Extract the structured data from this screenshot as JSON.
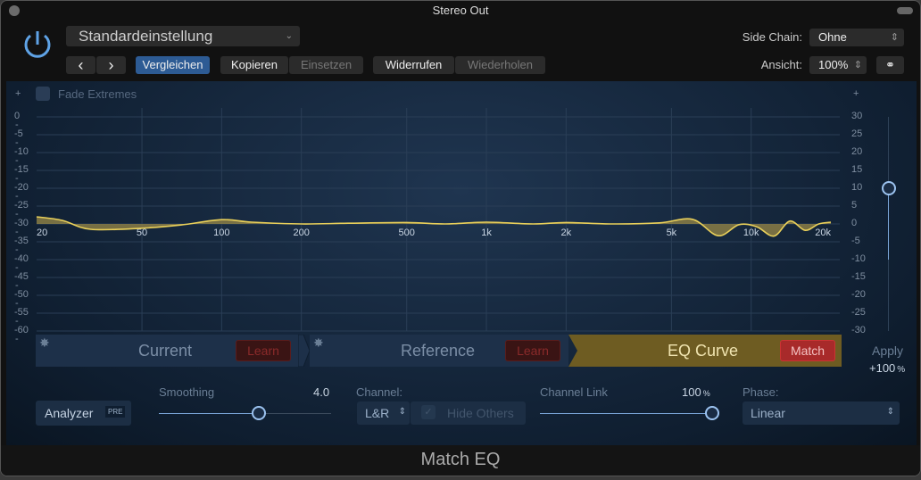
{
  "window": {
    "title": "Stereo Out"
  },
  "header": {
    "preset": "Standardeinstellung",
    "compare": "Vergleichen",
    "copy": "Kopieren",
    "paste": "Einsetzen",
    "undo": "Widerrufen",
    "redo": "Wiederholen",
    "prev": "‹",
    "next": "›",
    "side_chain_label": "Side Chain:",
    "side_chain_value": "Ohne",
    "view_label": "Ansicht:",
    "view_value": "100%"
  },
  "graph": {
    "fade_extremes": "Fade Extremes",
    "fade_extremes_checked": false,
    "left_scale": [
      "0",
      "-5",
      "-10",
      "-15",
      "-20",
      "-25",
      "-30",
      "-35",
      "-40",
      "-45",
      "-50",
      "-55",
      "-60"
    ],
    "right_scale": [
      "30",
      "25",
      "20",
      "15",
      "10",
      "5",
      "0",
      "-5",
      "-10",
      "-15",
      "-20",
      "-25",
      "-30"
    ],
    "freq_labels": [
      {
        "f": 20,
        "t": "20"
      },
      {
        "f": 50,
        "t": "50"
      },
      {
        "f": 100,
        "t": "100"
      },
      {
        "f": 200,
        "t": "200"
      },
      {
        "f": 500,
        "t": "500"
      },
      {
        "f": 1000,
        "t": "1k"
      },
      {
        "f": 2000,
        "t": "2k"
      },
      {
        "f": 5000,
        "t": "5k"
      },
      {
        "f": 10000,
        "t": "10k"
      },
      {
        "f": 20000,
        "t": "20k"
      }
    ],
    "curve_db": [
      [
        20,
        2
      ],
      [
        25,
        1
      ],
      [
        32,
        -1.5
      ],
      [
        50,
        -1.2
      ],
      [
        70,
        -0.3
      ],
      [
        100,
        1.2
      ],
      [
        130,
        0.5
      ],
      [
        200,
        0
      ],
      [
        300,
        0.2
      ],
      [
        500,
        0.4
      ],
      [
        700,
        0
      ],
      [
        1000,
        0.5
      ],
      [
        1500,
        0
      ],
      [
        2000,
        0.4
      ],
      [
        3000,
        0
      ],
      [
        4500,
        0.3
      ],
      [
        6000,
        1.3
      ],
      [
        7500,
        -3.3
      ],
      [
        9000,
        -0.2
      ],
      [
        10500,
        -0.8
      ],
      [
        12200,
        -3.4
      ],
      [
        14000,
        0.8
      ],
      [
        16000,
        -1.8
      ],
      [
        18000,
        0
      ],
      [
        20000,
        0.5
      ]
    ],
    "curve_color": "#e8cf5a",
    "apply_label": "Apply",
    "apply_value": "+100",
    "apply_unit": "%",
    "apply_db": 10
  },
  "segments": {
    "current": "Current",
    "reference": "Reference",
    "eq_curve": "EQ Curve",
    "learn": "Learn",
    "match": "Match"
  },
  "controls": {
    "analyzer": "Analyzer",
    "pre": "PRE",
    "smoothing_label": "Smoothing",
    "smoothing_value": "4.0",
    "smoothing_fraction": 0.58,
    "channel_label": "Channel:",
    "channel_value": "L&R",
    "hide_others": "Hide Others",
    "channel_link_label": "Channel Link",
    "channel_link_value": "100",
    "channel_link_unit": "%",
    "channel_link_fraction": 1.0,
    "phase_label": "Phase:",
    "phase_value": "Linear"
  },
  "footer": {
    "plugin_name": "Match EQ"
  }
}
